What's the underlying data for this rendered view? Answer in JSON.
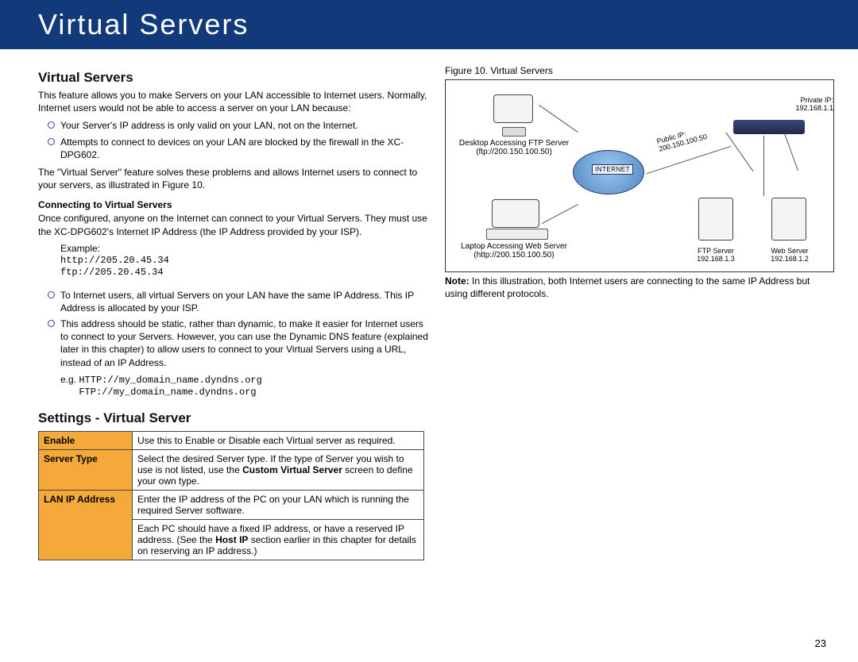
{
  "header": {
    "title": "Virtual Servers"
  },
  "left": {
    "h2": "Virtual Servers",
    "intro": "This feature allows you to make Servers on your LAN accessible to Internet users. Normally, Internet users would not be able to access a server on your LAN because:",
    "bullets1": [
      "Your Server's IP address is only valid on your LAN, not on the Internet.",
      "Attempts to connect to devices on your LAN are blocked by the firewall in the XC-DPG602."
    ],
    "solve": "The \"Virtual Server\" feature solves these problems and allows Internet users to connect to your servers, as illustrated in Figure 10.",
    "conn_h": "Connecting to Virtual Servers",
    "conn_p": "Once configured, anyone on the Internet can connect to your Virtual Servers. They must use the XC-DPG602's Internet IP Address (the IP Address provided by your ISP).",
    "example_label": "Example:",
    "ex1": "http://205.20.45.34",
    "ex2": "ftp://205.20.45.34",
    "bullets2": [
      "To Internet users, all virtual Servers on your LAN have the same IP Address. This IP Address is allocated by your ISP.",
      "This address should be static, rather than dynamic, to make it easier for Internet users to connect to your Servers. However, you can use the Dynamic DNS feature (explained later in this chapter) to allow users to connect to your Virtual Servers using a URL, instead of an IP Address."
    ],
    "eg_prefix": "e.g. ",
    "eg1": "HTTP://my_domain_name.dyndns.org",
    "eg2": "FTP://my_domain_name.dyndns.org",
    "settings_h": "Settings - Virtual Server",
    "table": {
      "r1l": "Enable",
      "r1v": "Use this to Enable or Disable each Virtual server as required.",
      "r2l": "Server Type",
      "r2v_a": "Select the desired Server type. If the type of Server you wish to use is not listed, use the ",
      "r2v_b": "Custom Virtual Server",
      "r2v_c": " screen to define your own type.",
      "r3l": "LAN IP Address",
      "r3v": "Enter the IP address of the PC on your LAN which is running the required Server software.",
      "r3v2_a": "Each PC should have a fixed IP address, or have a reserved IP address. (See the ",
      "r3v2_b": "Host IP",
      "r3v2_c": " section earlier in this chapter for details on reserving an IP address.)"
    }
  },
  "right": {
    "caption": "Figure 10.  Virtual Servers",
    "desktop_label": "Desktop Accessing FTP Server",
    "desktop_url": "(ftp://200.150.100.50)",
    "laptop_label": "Laptop Accessing Web Server",
    "laptop_url": "(http://200.150.100.50)",
    "internet": "INTERNET",
    "pubip_l": "Public IP:",
    "pubip_v": "200.150.100.50",
    "priv_l": "Private IP:",
    "priv_v": "192.168.1.1",
    "ftp_l": "FTP Server",
    "ftp_ip": "192.168.1.3",
    "web_l": "Web Server",
    "web_ip": "192.168.1.2",
    "note_b": "Note:",
    "note": " In this illustration, both Internet users are connecting to the same IP Address but using different protocols."
  },
  "page_number": "23"
}
